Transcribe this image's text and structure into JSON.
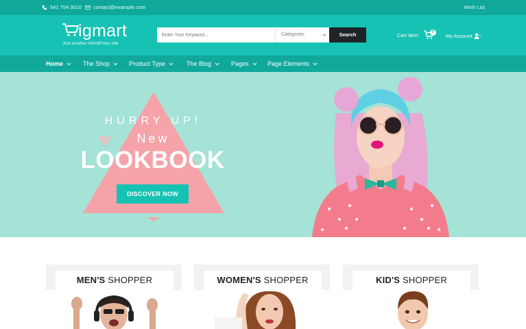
{
  "topbar": {
    "phone": "541 754 3010",
    "email": "contact@example.com",
    "wishlist": "Wish List"
  },
  "header": {
    "logo_name": "igmart",
    "tagline": "Just another WordPress site",
    "search_placeholder": "Enter Your Keyword...",
    "category_label": "Categories",
    "search_button": "Search",
    "cart_label": "Cart Item",
    "cart_count": "0",
    "account_label": "My Account"
  },
  "nav": {
    "items": [
      {
        "label": "Home"
      },
      {
        "label": "The Shop"
      },
      {
        "label": "Product Type"
      },
      {
        "label": "The Blog"
      },
      {
        "label": "Pages"
      },
      {
        "label": "Page Elements"
      }
    ]
  },
  "hero": {
    "hurry": "HURRY UP!",
    "new": "New",
    "headline": "LOOKBOOK",
    "cta": "DISCOVER NOW"
  },
  "cards": [
    {
      "strong": "MEN'S",
      "rest": " SHOPPER"
    },
    {
      "strong": "WOMEN'S",
      "rest": " SHOPPER"
    },
    {
      "strong": "KID'S",
      "rest": " SHOPPER"
    }
  ],
  "colors": {
    "teal": "#16c2b3",
    "dark_teal": "#10a89b",
    "mint": "#a4e3d6",
    "pink": "#f5a3a9",
    "dark": "#1f2428"
  },
  "icons": [
    "phone-icon",
    "mail-icon",
    "cart-icon",
    "user-icon",
    "chevron-down-icon"
  ]
}
